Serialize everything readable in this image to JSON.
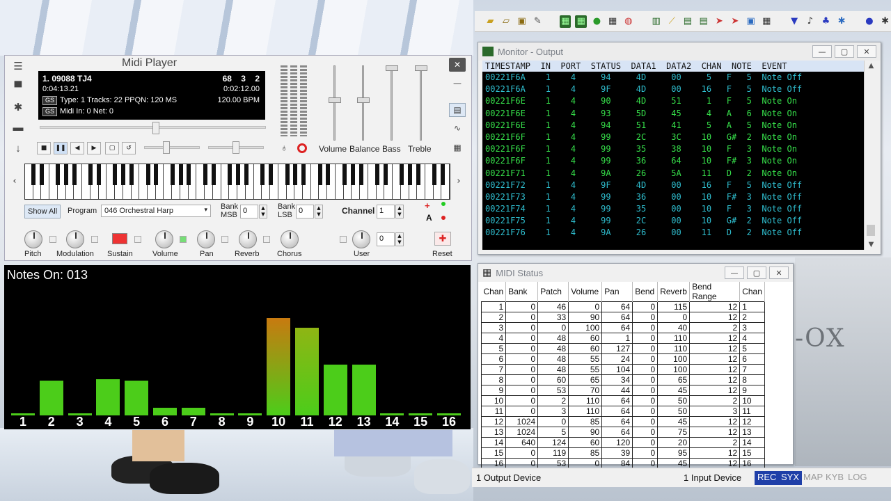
{
  "midi_player": {
    "title": "Midi Player",
    "lcd": {
      "song": "1. 09088 TJ4",
      "counters": [
        "68",
        "3",
        "2"
      ],
      "elapsed": "0:04:13.21",
      "position": "0:02:12.00",
      "type_info": "Type: 1  Tracks: 22  PPQN: 120  MS",
      "bpm": "120.00 BPM",
      "midi_in": "Midi In: 0  Net: 0",
      "gs": "GS"
    },
    "sliders": [
      "Volume",
      "Balance",
      "Bass",
      "Treble"
    ],
    "show_all": "Show All",
    "program_label": "Program",
    "program_value": "046 Orchestral Harp",
    "bank_msb_label": "Bank MSB",
    "bank_msb_value": "0",
    "bank_lsb_label": "Bank LSB",
    "bank_lsb_value": "0",
    "channel_label": "Channel",
    "channel_value": "1",
    "a_label": "A",
    "knobs": [
      "Pitch",
      "Modulation",
      "Sustain",
      "Volume",
      "Pan",
      "Reverb",
      "Chorus",
      "User",
      "Reset"
    ],
    "user_value": "0"
  },
  "notes_viz": {
    "title": "Notes On: 013",
    "channels": [
      "1",
      "2",
      "3",
      "4",
      "5",
      "6",
      "7",
      "8",
      "9",
      "10",
      "11",
      "12",
      "13",
      "14",
      "15",
      "16"
    ],
    "levels": [
      0.02,
      0.36,
      0.02,
      0.37,
      0.36,
      0.08,
      0.08,
      0.02,
      0.02,
      1.0,
      0.9,
      0.52,
      0.52,
      0.02,
      0.02,
      0.02
    ],
    "bar_color": "#4ccd1a",
    "peak_color": "#c87a10"
  },
  "monitor": {
    "title": "Monitor - Output",
    "header": "TIMESTAMP  IN  PORT  STATUS  DATA1  DATA2  CHAN  NOTE  EVENT",
    "rows": [
      {
        "text": "00221F6A    1    4     94     4D     00     5   F   5  Note Off",
        "on": false
      },
      {
        "text": "00221F6A    1    4     9F     4D     00    16   F   5  Note Off",
        "on": false
      },
      {
        "text": "00221F6E    1    4     90     4D     51     1   F   5  Note On",
        "on": true
      },
      {
        "text": "00221F6E    1    4     93     5D     45     4   A   6  Note On",
        "on": true
      },
      {
        "text": "00221F6E    1    4     94     51     41     5   A   5  Note On",
        "on": true
      },
      {
        "text": "00221F6F    1    4     99     2C     3C    10   G#  2  Note On",
        "on": true
      },
      {
        "text": "00221F6F    1    4     99     35     38    10   F   3  Note On",
        "on": true
      },
      {
        "text": "00221F6F    1    4     99     36     64    10   F#  3  Note On",
        "on": true
      },
      {
        "text": "00221F71    1    4     9A     26     5A    11   D   2  Note On",
        "on": true
      },
      {
        "text": "00221F72    1    4     9F     4D     00    16   F   5  Note Off",
        "on": false
      },
      {
        "text": "00221F73    1    4     99     36     00    10   F#  3  Note Off",
        "on": false
      },
      {
        "text": "00221F74    1    4     99     35     00    10   F   3  Note Off",
        "on": false
      },
      {
        "text": "00221F75    1    4     99     2C     00    10   G#  2  Note Off",
        "on": false
      },
      {
        "text": "00221F76    1    4     9A     26     00    11   D   2  Note Off",
        "on": false
      }
    ],
    "on_color": "#36e04a",
    "off_color": "#2fbfd0"
  },
  "midi_status": {
    "title": "MIDI Status",
    "columns": [
      "Chan",
      "Bank",
      "Patch",
      "Volume",
      "Pan",
      "Bend",
      "Reverb",
      "Bend Range",
      "Chan"
    ],
    "rows": [
      [
        "1",
        "0",
        "46",
        "0",
        "64",
        "0",
        "115",
        "12",
        "1"
      ],
      [
        "2",
        "0",
        "33",
        "90",
        "64",
        "0",
        "0",
        "12",
        "2"
      ],
      [
        "3",
        "0",
        "0",
        "100",
        "64",
        "0",
        "40",
        "2",
        "3"
      ],
      [
        "4",
        "0",
        "48",
        "60",
        "1",
        "0",
        "110",
        "12",
        "4"
      ],
      [
        "5",
        "0",
        "48",
        "60",
        "127",
        "0",
        "110",
        "12",
        "5"
      ],
      [
        "6",
        "0",
        "48",
        "55",
        "24",
        "0",
        "100",
        "12",
        "6"
      ],
      [
        "7",
        "0",
        "48",
        "55",
        "104",
        "0",
        "100",
        "12",
        "7"
      ],
      [
        "8",
        "0",
        "60",
        "65",
        "34",
        "0",
        "65",
        "12",
        "8"
      ],
      [
        "9",
        "0",
        "53",
        "70",
        "44",
        "0",
        "45",
        "12",
        "9"
      ],
      [
        "10",
        "0",
        "2",
        "110",
        "64",
        "0",
        "50",
        "2",
        "10"
      ],
      [
        "11",
        "0",
        "3",
        "110",
        "64",
        "0",
        "50",
        "3",
        "11"
      ],
      [
        "12",
        "1024",
        "0",
        "85",
        "64",
        "0",
        "45",
        "12",
        "12"
      ],
      [
        "13",
        "1024",
        "5",
        "90",
        "64",
        "0",
        "75",
        "12",
        "13"
      ],
      [
        "14",
        "640",
        "124",
        "60",
        "120",
        "0",
        "20",
        "2",
        "14"
      ],
      [
        "15",
        "0",
        "119",
        "85",
        "39",
        "0",
        "95",
        "12",
        "15"
      ],
      [
        "16",
        "0",
        "53",
        "0",
        "84",
        "0",
        "45",
        "12",
        "16"
      ]
    ]
  },
  "statusbar": {
    "output_device": "1 Output Device",
    "input_device": "1 Input Device",
    "chips": [
      "REC",
      "SYX",
      "MAP",
      "KYB",
      "LOG"
    ]
  },
  "background": {
    "logo": "-OX"
  }
}
